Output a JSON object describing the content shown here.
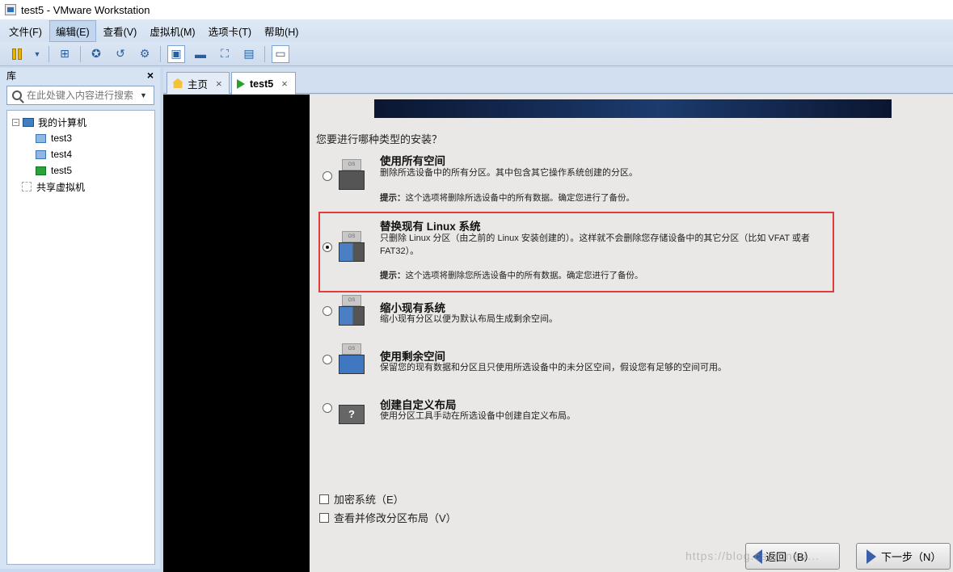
{
  "window": {
    "title": "test5 - VMware Workstation"
  },
  "menu": {
    "items": [
      "文件(F)",
      "编辑(E)",
      "查看(V)",
      "虚拟机(M)",
      "选项卡(T)",
      "帮助(H)"
    ]
  },
  "toolbar": {
    "icons": [
      "pause-icon",
      "dropdown-icon",
      "network-icon",
      "snapshot-icon",
      "revert-icon",
      "snapshot-manager-icon",
      "normal-view-icon",
      "console-view-icon",
      "fullscreen-icon",
      "unity-icon",
      "thumbnail-icon"
    ]
  },
  "library": {
    "title": "库",
    "close": "×",
    "search_placeholder": "在此处键入内容进行搜索",
    "tree": {
      "root": "我的计算机",
      "vms": [
        "test3",
        "test4",
        "test5"
      ],
      "shared": "共享虚拟机"
    }
  },
  "tabs": [
    {
      "label": "主页",
      "close": "×"
    },
    {
      "label": "test5",
      "close": "×"
    }
  ],
  "installer": {
    "question": "您要进行哪种类型的安装？",
    "options": [
      {
        "title": "使用所有空间",
        "desc": "删除所选设备中的所有分区。其中包含其它操作系统创建的分区。",
        "hint_label": "提示：",
        "hint": "这个选项将删除所选设备中的所有数据。确定您进行了备份。",
        "selected": false
      },
      {
        "title": "替换现有 Linux 系统",
        "desc": "只删除 Linux 分区（由之前的 Linux 安装创建的）。这样就不会删除您存储设备中的其它分区（比如 VFAT 或者 FAT32）。",
        "hint_label": "提示：",
        "hint": "这个选项将删除您所选设备中的所有数据。确定您进行了备份。",
        "selected": true
      },
      {
        "title": "缩小现有系统",
        "desc": "缩小现有分区以便为默认布局生成剩余空间。",
        "selected": false
      },
      {
        "title": "使用剩余空间",
        "desc": "保留您的现有数据和分区且只使用所选设备中的未分区空间，假设您有足够的空间可用。",
        "selected": false
      },
      {
        "title": "创建自定义布局",
        "desc": "使用分区工具手动在所选设备中创建自定义布局。",
        "selected": false
      }
    ],
    "os_label": "OS",
    "custom_icon_label": "?",
    "checkboxes": [
      "加密系统（E）",
      "查看并修改分区布局（V）"
    ],
    "back_label": "返回（B）",
    "next_label": "下一步（N）"
  },
  "watermark": "https://blog.csdn.net/..."
}
